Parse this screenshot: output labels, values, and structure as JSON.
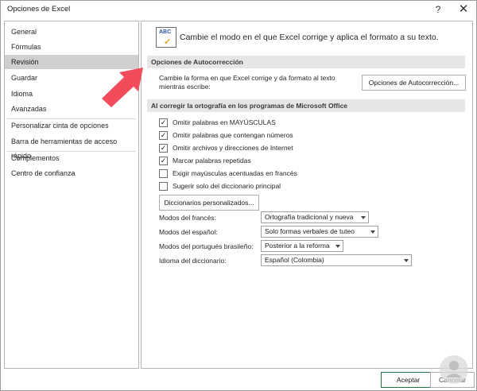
{
  "window": {
    "title": "Opciones de Excel",
    "help": "?",
    "close": "✕"
  },
  "sidebar": {
    "items": [
      {
        "label": "General"
      },
      {
        "label": "Fórmulas"
      },
      {
        "label": "Revisión"
      },
      {
        "label": "Guardar"
      },
      {
        "label": "Idioma"
      },
      {
        "label": "Avanzadas"
      },
      {
        "label": "Personalizar cinta de opciones"
      },
      {
        "label": "Barra de herramientas de acceso rápido"
      },
      {
        "label": "Complementos"
      },
      {
        "label": "Centro de confianza"
      }
    ],
    "active_index": 2
  },
  "header": {
    "icon_text": "ABC",
    "text": "Cambie el modo en el que Excel corrige y aplica el formato a su texto."
  },
  "autocorrect": {
    "title": "Opciones de Autocorrección",
    "desc_line1": "Cambie la forma en que Excel corrige y da formato al texto",
    "desc_line2": "mientras escribe:",
    "button": "Opciones de Autocorrección..."
  },
  "spelling": {
    "title": "Al corregir la ortografía en los programas de Microsoft Office",
    "checks": [
      {
        "label": "Omitir palabras en MAYÚSCULAS",
        "checked": true
      },
      {
        "label": "Omitir palabras que contengan números",
        "checked": true
      },
      {
        "label": "Omitir archivos y direcciones de Internet",
        "checked": true
      },
      {
        "label": "Marcar palabras repetidas",
        "checked": true
      },
      {
        "label": "Exigir mayúsculas acentuadas en francés",
        "checked": false
      },
      {
        "label": "Sugerir solo del diccionario principal",
        "checked": false
      }
    ],
    "dict_button": "Diccionarios personalizados...",
    "selects": [
      {
        "label": "Modos del francés:",
        "value": "Ortografía tradicional y nueva"
      },
      {
        "label": "Modos del español:",
        "value": "Solo formas verbales de tuteo"
      },
      {
        "label": "Modos del portugués brasileño:",
        "value": "Posterior a la reforma"
      },
      {
        "label": "Idioma del diccionario:",
        "value": "Español (Colombia)"
      }
    ]
  },
  "footer": {
    "ok": "Aceptar",
    "cancel": "Cancelar"
  },
  "colors": {
    "accent_green": "#217346",
    "arrow": "#f24b5a",
    "active_nav": "#cfcfcf",
    "section_bg": "#e6e6e6"
  }
}
